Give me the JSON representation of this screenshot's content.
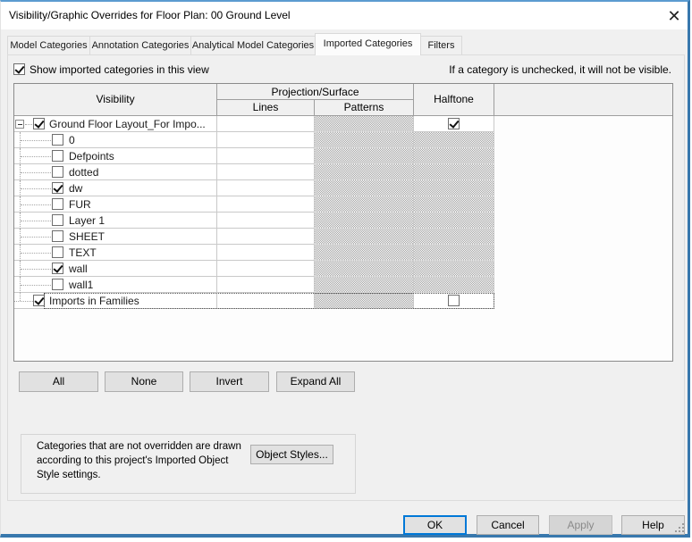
{
  "window": {
    "title": "Visibility/Graphic Overrides for Floor Plan: 00 Ground Level",
    "close_glyph": "✕"
  },
  "tabs": [
    {
      "label": "Model Categories",
      "active": false
    },
    {
      "label": "Annotation Categories",
      "active": false
    },
    {
      "label": "Analytical Model Categories",
      "active": false
    },
    {
      "label": "Imported Categories",
      "active": true
    },
    {
      "label": "Filters",
      "active": false
    }
  ],
  "view_toggle": {
    "label": "Show imported categories in this view",
    "checked": true
  },
  "note": "If a category is unchecked, it will not be visible.",
  "table": {
    "headers": {
      "visibility": "Visibility",
      "projection_surface": "Projection/Surface",
      "lines": "Lines",
      "patterns": "Patterns",
      "halftone": "Halftone"
    },
    "rows": [
      {
        "label": "Ground Floor Layout_For Impo...",
        "level": 0,
        "expander": "minus",
        "checked": true,
        "halftone": "checked"
      },
      {
        "label": "0",
        "level": 1,
        "checked": false
      },
      {
        "label": "Defpoints",
        "level": 1,
        "checked": false
      },
      {
        "label": "dotted",
        "level": 1,
        "checked": false
      },
      {
        "label": "dw",
        "level": 1,
        "checked": true
      },
      {
        "label": "FUR",
        "level": 1,
        "checked": false
      },
      {
        "label": "Layer 1",
        "level": 1,
        "checked": false
      },
      {
        "label": "SHEET",
        "level": 1,
        "checked": false
      },
      {
        "label": "TEXT",
        "level": 1,
        "checked": false
      },
      {
        "label": "wall",
        "level": 1,
        "checked": true
      },
      {
        "label": "wall1",
        "level": 1,
        "checked": false
      },
      {
        "label": "Imports in Families",
        "level": 0,
        "checked": true,
        "halftone": "unchecked",
        "focused": true
      }
    ]
  },
  "actions": {
    "all": "All",
    "none": "None",
    "invert": "Invert",
    "expand_all": "Expand All"
  },
  "info_box": {
    "text": "Categories that are not overridden are drawn according to this project's Imported Object Style settings.",
    "button": "Object Styles..."
  },
  "footer": {
    "ok": "OK",
    "cancel": "Cancel",
    "apply": "Apply",
    "help": "Help"
  }
}
